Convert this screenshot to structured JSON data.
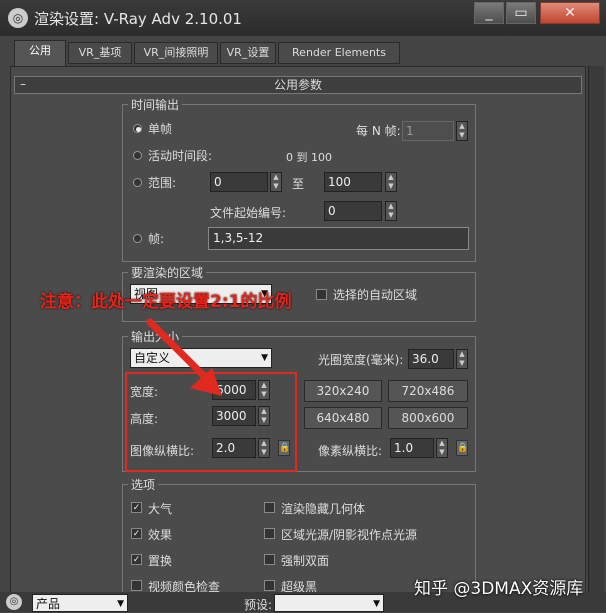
{
  "window": {
    "title": "渲染设置: V-Ray Adv 2.10.01",
    "controls": [
      "_",
      "▭",
      "✕"
    ]
  },
  "tabs": [
    {
      "label": "公用"
    },
    {
      "label": "VR_基项"
    },
    {
      "label": "VR_间接照明"
    },
    {
      "label": "VR_设置"
    },
    {
      "label": "Render Elements"
    }
  ],
  "rollout": {
    "minus": "–",
    "title": "公用参数"
  },
  "time_output": {
    "group": "时间输出",
    "single": "单帧",
    "every_n_label": "每 N 帧:",
    "every_n_value": "1",
    "active_segment": "活动时间段:",
    "active_range": "0 到 100",
    "range_label": "范围:",
    "range_from": "0",
    "range_to_label": "至",
    "range_to": "100",
    "file_start_label": "文件起始编号:",
    "file_start": "0",
    "frames_label": "帧:",
    "frames_value": "1,3,5-12"
  },
  "render_area": {
    "group": "要渲染的区域",
    "mode": "视图",
    "auto_region": "选择的自动区域"
  },
  "annotation": "注意：此处一定要设置2:1的比例",
  "output_size": {
    "group": "输出大小",
    "preset": "自定义",
    "aperture_label": "光圈宽度(毫米):",
    "aperture_value": "36.0",
    "width_label": "宽度:",
    "width_value": "6000",
    "height_label": "高度:",
    "height_value": "3000",
    "aspect_label": "图像纵横比:",
    "aspect_value": "2.0",
    "pixel_aspect_label": "像素纵横比:",
    "pixel_aspect_value": "1.0",
    "presets": [
      "320x240",
      "720x486",
      "640x480",
      "800x600"
    ]
  },
  "options": {
    "group": "选项",
    "left": [
      {
        "label": "大气",
        "checked": true
      },
      {
        "label": "效果",
        "checked": true
      },
      {
        "label": "置换",
        "checked": true
      },
      {
        "label": "视频颜色检查",
        "checked": false
      }
    ],
    "right": [
      {
        "label": "渲染隐藏几何体",
        "checked": false
      },
      {
        "label": "区域光源/阴影视作点光源",
        "checked": false
      },
      {
        "label": "强制双面",
        "checked": false
      },
      {
        "label": "超级黑",
        "checked": false
      }
    ]
  },
  "bottom": {
    "mode": "产品",
    "preset_label": "预设:"
  },
  "watermark": "知乎 @3DMAX资源库"
}
